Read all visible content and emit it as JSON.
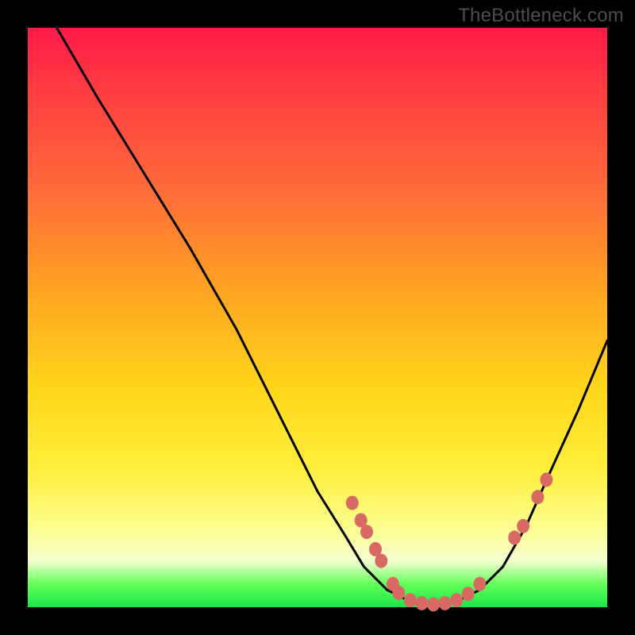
{
  "watermark": "TheBottleneck.com",
  "chart_data": {
    "type": "line",
    "title": "",
    "xlabel": "",
    "ylabel": "",
    "xlim": [
      0,
      100
    ],
    "ylim": [
      0,
      100
    ],
    "curve": {
      "comment": "Approximate (x%, y%) pairs for the black V-shaped curve; y=100 is top, y=0 is valley floor",
      "points": [
        [
          5,
          100
        ],
        [
          12,
          88
        ],
        [
          20,
          75
        ],
        [
          28,
          62
        ],
        [
          36,
          48
        ],
        [
          43,
          34
        ],
        [
          50,
          20
        ],
        [
          55,
          12
        ],
        [
          58,
          7
        ],
        [
          62,
          3
        ],
        [
          66,
          1
        ],
        [
          70,
          0.5
        ],
        [
          74,
          1
        ],
        [
          78,
          3
        ],
        [
          82,
          7
        ],
        [
          86,
          14
        ],
        [
          90,
          23
        ],
        [
          95,
          34
        ],
        [
          100,
          46
        ]
      ]
    },
    "markers": {
      "comment": "Salmon-colored rounded markers near the valley floor and partway up each side",
      "points": [
        [
          56,
          18
        ],
        [
          57.5,
          15
        ],
        [
          58.5,
          13
        ],
        [
          60,
          10
        ],
        [
          61,
          8
        ],
        [
          63,
          4
        ],
        [
          64,
          2.5
        ],
        [
          66,
          1.2
        ],
        [
          68,
          0.7
        ],
        [
          70,
          0.5
        ],
        [
          72,
          0.7
        ],
        [
          74,
          1.2
        ],
        [
          76,
          2.3
        ],
        [
          78,
          4
        ],
        [
          84,
          12
        ],
        [
          85.5,
          14
        ],
        [
          88,
          19
        ],
        [
          89.5,
          22
        ]
      ],
      "color": "#d86a63"
    }
  }
}
